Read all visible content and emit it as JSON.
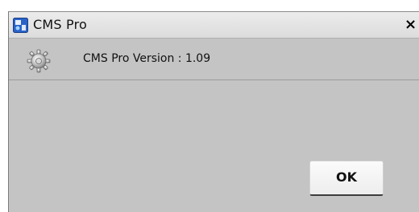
{
  "window": {
    "title": "CMS Pro",
    "close_label": "×",
    "app_icon": "cms-pro-app-icon"
  },
  "dialog": {
    "icon": "gear-icon",
    "version_text": "CMS Pro Version : 1.09",
    "ok_label": "OK"
  },
  "colors": {
    "dialog_background": "#c4c4c4",
    "titlebar_background": "#e4e4e4",
    "app_icon_blue": "#2a63c8"
  }
}
